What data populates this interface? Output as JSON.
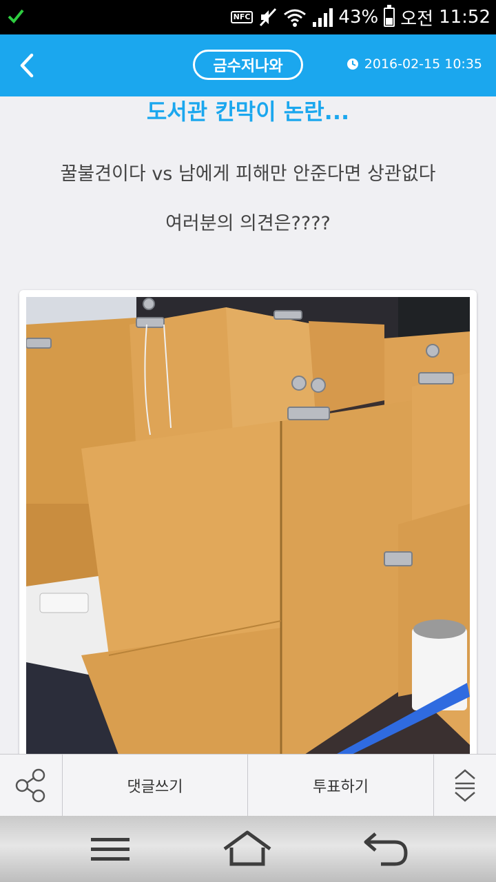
{
  "status_bar": {
    "nfc_label": "NFC",
    "battery_percent": "43%",
    "battery_level": 0.43,
    "ampm": "오전",
    "time": "11:52",
    "icons": [
      "check-icon",
      "nfc-icon",
      "mute-icon",
      "wifi-icon",
      "signal-icon",
      "battery-icon"
    ]
  },
  "header": {
    "channel": "금수저나와",
    "timestamp": "2016-02-15 10:35",
    "accent_color": "#1ba7ee"
  },
  "post": {
    "title": "도서관 칸막이 논란...",
    "line1": "꿀불견이다 vs 남에게 피해만 안준다면 상관없다",
    "line2": "여러분의 의견은????"
  },
  "actions": {
    "comment_label": "댓글쓰기",
    "vote_label": "투표하기"
  }
}
